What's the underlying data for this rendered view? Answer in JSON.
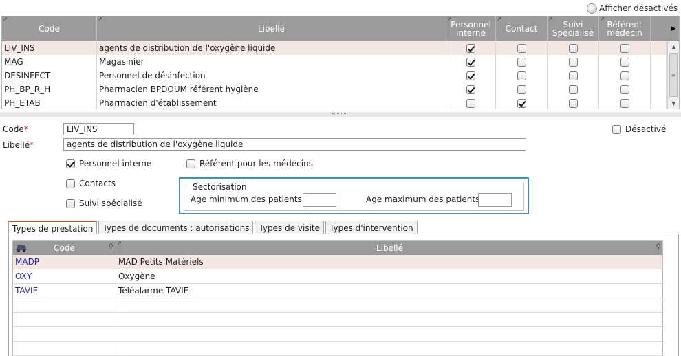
{
  "toolbar": {
    "show_disabled_label": "Afficher désactivés"
  },
  "top_grid": {
    "columns": [
      "Code",
      "Libellé",
      "Personnel interne",
      "Contact",
      "Suivi Specialisé",
      "Référent médecin"
    ],
    "rows": [
      {
        "code": "LIV_INS",
        "label": "agents de distribution de l'oxygène liquide",
        "interne": true,
        "contact": false,
        "suivi": false,
        "referent": false,
        "selected": true
      },
      {
        "code": "MAG",
        "label": "Magasinier",
        "interne": true,
        "contact": false,
        "suivi": false,
        "referent": false
      },
      {
        "code": "DESINFECT",
        "label": "Personnel de désinfection",
        "interne": true,
        "contact": false,
        "suivi": false,
        "referent": false
      },
      {
        "code": "PH_BP_R_H",
        "label": "Pharmacien BPDOUM référent hygiène",
        "interne": true,
        "contact": false,
        "suivi": false,
        "referent": false
      },
      {
        "code": "PH_ETAB",
        "label": "Pharmacien d'établissement",
        "interne": false,
        "contact": true,
        "suivi": false,
        "referent": false
      }
    ]
  },
  "form": {
    "code_label": "Code",
    "code_value": "LIV_INS",
    "libelle_label": "Libellé",
    "libelle_value": "agents de distribution de l'oxygène liquide",
    "required_mark": "*",
    "disabled_label": "Désactivé",
    "disabled_checked": false,
    "personnel_interne_label": "Personnel interne",
    "personnel_interne_checked": true,
    "referent_label": "Référent pour les médecins",
    "referent_checked": false,
    "contacts_label": "Contacts",
    "contacts_checked": false,
    "suivi_label": "Suivi spécialisé",
    "suivi_checked": false,
    "sectorisation": {
      "legend": "Sectorisation",
      "age_min_label": "Age minimum des patients",
      "age_min_value": "",
      "age_max_label": "Age maximum des patients",
      "age_max_value": ""
    }
  },
  "tabs": [
    {
      "label": "Types de prestation",
      "active": true
    },
    {
      "label": "Types de documents : autorisations",
      "active": false
    },
    {
      "label": "Types de visite",
      "active": false
    },
    {
      "label": "Types d'intervention",
      "active": false
    }
  ],
  "bottom_grid": {
    "columns": [
      "Code",
      "Libellé"
    ],
    "rows": [
      {
        "code": "MADP",
        "label": "MAD Petits Matériels",
        "selected": true
      },
      {
        "code": "OXY",
        "label": "Oxygène"
      },
      {
        "code": "TAVIE",
        "label": "Téléalarme TAVIE"
      }
    ]
  },
  "colors": {
    "header_bg": "#9b9b9b",
    "selected_row": "#f3e6e3",
    "accent_tab": "#d04b2a",
    "section_border": "#3f8fb8",
    "code_link": "#2a2ab0"
  },
  "icons": [
    "radio-disk-icon",
    "sort-indicator-icon",
    "scroll-up-icon",
    "scroll-down-icon",
    "column-chooser-icon",
    "magnifier-icon"
  ]
}
